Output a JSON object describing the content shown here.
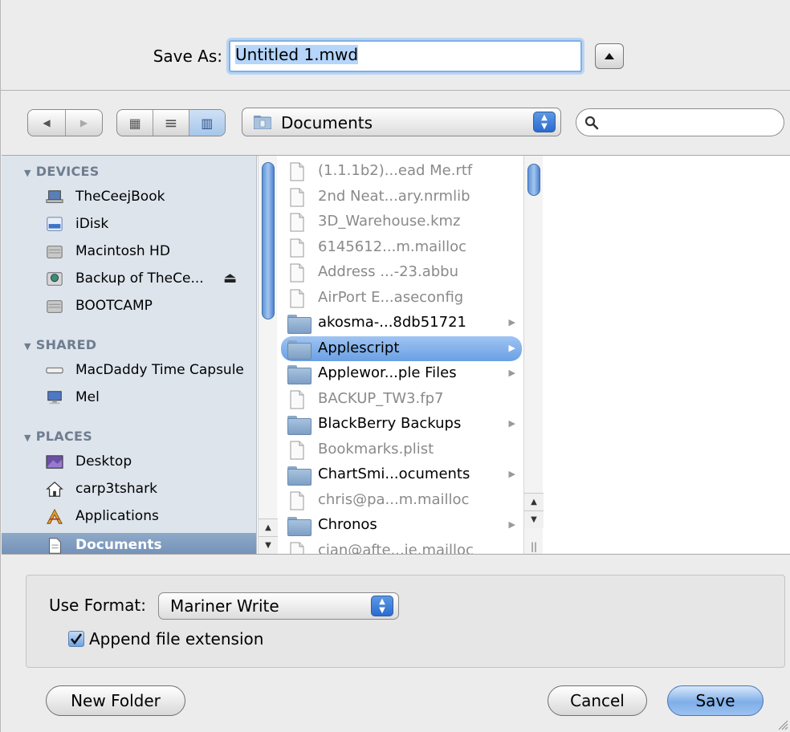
{
  "save_as": {
    "label": "Save As:",
    "filename": "Untitled 1.mwd"
  },
  "toolbar": {
    "back_glyph": "◀",
    "forward_glyph": "▶",
    "view_icon_glyph": "▦",
    "view_list_glyph": "≡",
    "view_column_glyph": "▥",
    "location": "Documents",
    "search_placeholder": ""
  },
  "sidebar": {
    "sections": [
      {
        "title": "DEVICES",
        "items": [
          {
            "label": "TheCeejBook",
            "icon": "laptop-icon"
          },
          {
            "label": "iDisk",
            "icon": "idisk-icon"
          },
          {
            "label": "Macintosh HD",
            "icon": "hard-drive-icon"
          },
          {
            "label": "Backup of TheCe...",
            "icon": "backup-drive-icon",
            "eject": "⏏"
          },
          {
            "label": "BOOTCAMP",
            "icon": "hard-drive-icon"
          }
        ]
      },
      {
        "title": "SHARED",
        "items": [
          {
            "label": "MacDaddy Time Capsule",
            "icon": "time-capsule-icon"
          },
          {
            "label": "Mel",
            "icon": "computer-icon"
          }
        ]
      },
      {
        "title": "PLACES",
        "items": [
          {
            "label": "Desktop",
            "icon": "desktop-icon"
          },
          {
            "label": "carp3tshark",
            "icon": "home-icon"
          },
          {
            "label": "Applications",
            "icon": "applications-icon"
          },
          {
            "label": "Documents",
            "icon": "documents-icon",
            "selected": true
          }
        ]
      }
    ]
  },
  "files": [
    {
      "name": "(1.1.1b2)...ead Me.rtf",
      "kind": "file",
      "dim": true
    },
    {
      "name": "2nd Neat...ary.nrmlib",
      "kind": "file",
      "dim": true
    },
    {
      "name": "3D_Warehouse.kmz",
      "kind": "file",
      "dim": true
    },
    {
      "name": "6145612...m.mailloc",
      "kind": "file",
      "dim": true
    },
    {
      "name": "Address ...-23.abbu",
      "kind": "file",
      "dim": true
    },
    {
      "name": "AirPort E...aseconfig",
      "kind": "file",
      "dim": true
    },
    {
      "name": "akosma-...8db51721",
      "kind": "folder",
      "dim": false
    },
    {
      "name": "Applescript",
      "kind": "folder",
      "dim": false,
      "selected": true
    },
    {
      "name": "Applewor...ple Files",
      "kind": "folder",
      "dim": false
    },
    {
      "name": "BACKUP_TW3.fp7",
      "kind": "file",
      "dim": true
    },
    {
      "name": "BlackBerry Backups",
      "kind": "folder",
      "dim": false
    },
    {
      "name": "Bookmarks.plist",
      "kind": "file",
      "dim": true
    },
    {
      "name": "ChartSmi...ocuments",
      "kind": "folder",
      "dim": false
    },
    {
      "name": "chris@pa...m.mailloc",
      "kind": "file",
      "dim": true
    },
    {
      "name": "Chronos",
      "kind": "folder",
      "dim": false
    },
    {
      "name": "cian@afte...ie.mailloc",
      "kind": "file",
      "dim": true
    }
  ],
  "format": {
    "label": "Use Format:",
    "value": "Mariner Write"
  },
  "append_extension": {
    "label": "Append file extension",
    "checked": true
  },
  "buttons": {
    "new_folder": "New Folder",
    "cancel": "Cancel",
    "save": "Save"
  },
  "colors": {
    "selection_blue": "#6aa0e4",
    "sidebar_bg": "#dde4ec",
    "sidebar_header": "#6f7d8f"
  }
}
